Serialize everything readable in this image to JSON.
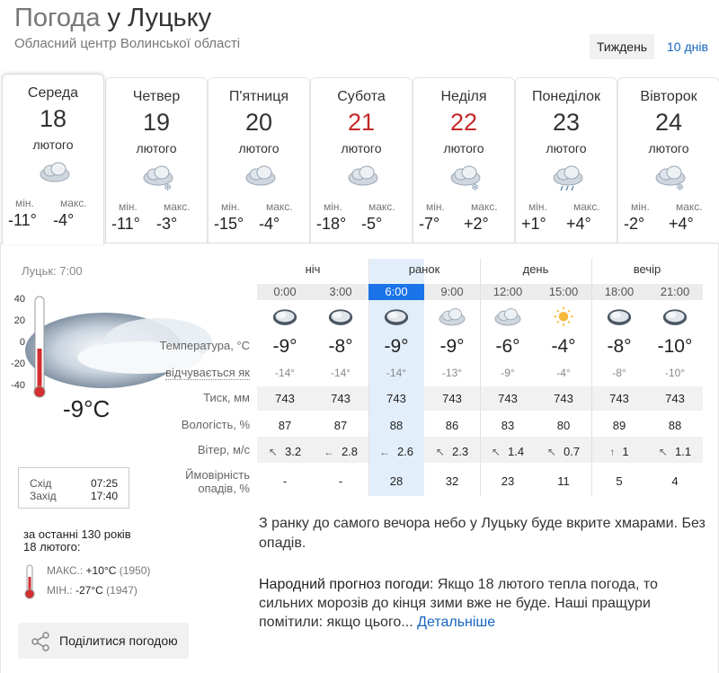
{
  "header": {
    "title_prefix": "Погода",
    "title_city": "у Луцьку",
    "subtitle": "Обласний центр Волинської області",
    "range_week": "Тиждень",
    "range_ten": "10 днів"
  },
  "days": [
    {
      "dow": "Середа",
      "num": "18",
      "month": "лютого",
      "min_label": "мін.",
      "max_label": "макс.",
      "min": "-11°",
      "max": "-4°",
      "icon": "cloud-icon",
      "weekend": false,
      "active": true
    },
    {
      "dow": "Четвер",
      "num": "19",
      "month": "лютого",
      "min_label": "мін.",
      "max_label": "макс.",
      "min": "-11°",
      "max": "-3°",
      "icon": "cloud-snow-icon",
      "weekend": false,
      "active": false
    },
    {
      "dow": "П'ятниця",
      "num": "20",
      "month": "лютого",
      "min_label": "мін.",
      "max_label": "макс.",
      "min": "-15°",
      "max": "-4°",
      "icon": "cloud-icon",
      "weekend": false,
      "active": false
    },
    {
      "dow": "Субота",
      "num": "21",
      "month": "лютого",
      "min_label": "мін.",
      "max_label": "макс.",
      "min": "-18°",
      "max": "-5°",
      "icon": "cloud-icon",
      "weekend": true,
      "active": false
    },
    {
      "dow": "Неділя",
      "num": "22",
      "month": "лютого",
      "min_label": "мін.",
      "max_label": "макс.",
      "min": "-7°",
      "max": "+2°",
      "icon": "cloud-snow-icon",
      "weekend": true,
      "active": false
    },
    {
      "dow": "Понеділок",
      "num": "23",
      "month": "лютого",
      "min_label": "мін.",
      "max_label": "макс.",
      "min": "+1°",
      "max": "+4°",
      "icon": "cloud-rain-icon",
      "weekend": false,
      "active": false
    },
    {
      "dow": "Вівторок",
      "num": "24",
      "month": "лютого",
      "min_label": "мін.",
      "max_label": "макс.",
      "min": "-2°",
      "max": "+4°",
      "icon": "cloud-snow-icon",
      "weekend": false,
      "active": false
    }
  ],
  "current": {
    "location_time": "Луцьк: 7:00",
    "temp": "-9°C",
    "scale": [
      "40",
      "20",
      "0",
      "-20",
      "-40"
    ],
    "sunrise_label": "Схід",
    "sunrise": "07:25",
    "sunset_label": "Захід",
    "sunset": "17:40"
  },
  "history": {
    "line1": "за останні 130 років",
    "line2": "18 лютого:",
    "max_label": "МАКС.:",
    "max_value": "+10°C",
    "max_year": "(1950)",
    "min_label": "МІН.:",
    "min_value": "-27°C",
    "min_year": "(1947)"
  },
  "share_label": "Поділитися погодою",
  "row_labels": {
    "temp": "Температура, °С",
    "feels": "відчувається як",
    "pressure": "Тиск, мм",
    "humidity": "Вологість, %",
    "wind": "Вітер, м/с",
    "prob1": "Ймовірність",
    "prob2": "опадів, %"
  },
  "phases": [
    "ніч",
    "ранок",
    "день",
    "вечір"
  ],
  "hours": [
    {
      "time": "0:00",
      "icon": "cloudy-night-icon",
      "temp": "-9°",
      "feels": "-14°",
      "pressure": "743",
      "humidity": "87",
      "wind_dir": "↖",
      "wind": "3.2",
      "prob": "-"
    },
    {
      "time": "3:00",
      "icon": "cloudy-night-icon",
      "temp": "-8°",
      "feels": "-14°",
      "pressure": "743",
      "humidity": "87",
      "wind_dir": "←",
      "wind": "2.8",
      "prob": "-"
    },
    {
      "time": "6:00",
      "icon": "cloudy-night-icon",
      "temp": "-9°",
      "feels": "-14°",
      "pressure": "743",
      "humidity": "88",
      "wind_dir": "←",
      "wind": "2.6",
      "prob": "28"
    },
    {
      "time": "9:00",
      "icon": "cloud-icon",
      "temp": "-9°",
      "feels": "-13°",
      "pressure": "743",
      "humidity": "86",
      "wind_dir": "↖",
      "wind": "2.3",
      "prob": "32"
    },
    {
      "time": "12:00",
      "icon": "cloud-icon",
      "temp": "-6°",
      "feels": "-9°",
      "pressure": "743",
      "humidity": "83",
      "wind_dir": "↖",
      "wind": "1.4",
      "prob": "23"
    },
    {
      "time": "15:00",
      "icon": "sun-icon",
      "temp": "-4°",
      "feels": "-4°",
      "pressure": "743",
      "humidity": "80",
      "wind_dir": "↖",
      "wind": "0.7",
      "prob": "11"
    },
    {
      "time": "18:00",
      "icon": "cloudy-night-icon",
      "temp": "-8°",
      "feels": "-8°",
      "pressure": "743",
      "humidity": "89",
      "wind_dir": "↑",
      "wind": "1",
      "prob": "5"
    },
    {
      "time": "21:00",
      "icon": "cloudy-night-icon",
      "temp": "-10°",
      "feels": "-10°",
      "pressure": "743",
      "humidity": "88",
      "wind_dir": "↖",
      "wind": "1.1",
      "prob": "4"
    }
  ],
  "description": "З ранку до самого вечора небо у Луцьку буде вкрите хмарами. Без опадів.",
  "folk": {
    "heading": "Народний прогноз погоди:",
    "text": "Якщо 18 лютого тепла погода, то сильних морозів до кінця зими вже не буде. Наші пращури помітили: якщо цього...",
    "link": "Детальніше"
  }
}
